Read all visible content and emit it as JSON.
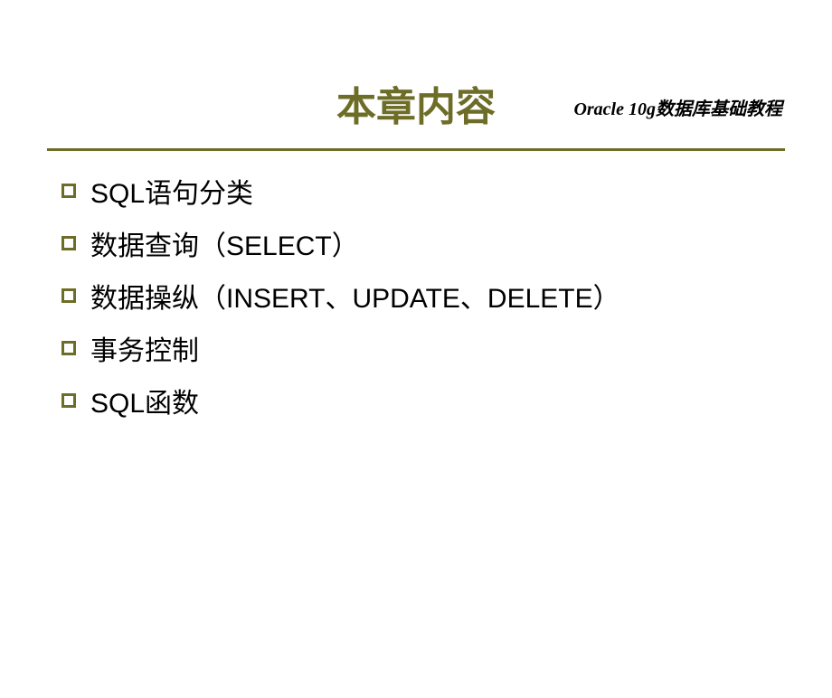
{
  "header": {
    "text": "Oracle 10g数据库基础教程"
  },
  "title": "本章内容",
  "items": [
    "SQL语句分类",
    "数据查询（SELECT）",
    "数据操纵（INSERT、UPDATE、DELETE）",
    "事务控制",
    "SQL函数"
  ]
}
